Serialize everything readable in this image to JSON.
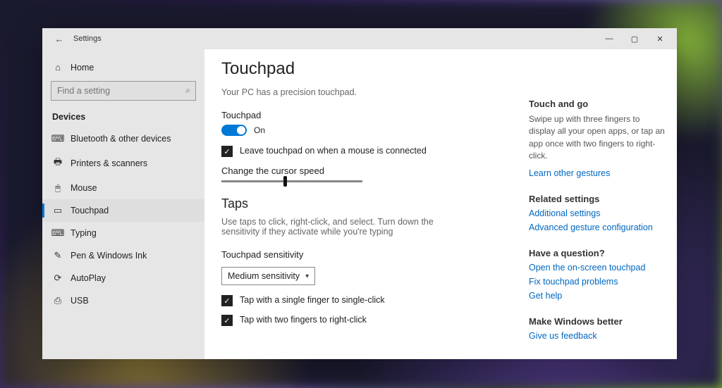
{
  "window": {
    "title": "Settings"
  },
  "sidebar": {
    "home_label": "Home",
    "search_placeholder": "Find a setting",
    "section_label": "Devices",
    "items": [
      {
        "label": "Bluetooth & other devices",
        "icon": "⌨"
      },
      {
        "label": "Printers & scanners",
        "icon": "🖶"
      },
      {
        "label": "Mouse",
        "icon": "🖱"
      },
      {
        "label": "Touchpad",
        "icon": "▭"
      },
      {
        "label": "Typing",
        "icon": "⌨"
      },
      {
        "label": "Pen & Windows Ink",
        "icon": "✎"
      },
      {
        "label": "AutoPlay",
        "icon": "⟳"
      },
      {
        "label": "USB",
        "icon": "⎙"
      }
    ],
    "active_index": 3
  },
  "main": {
    "heading": "Touchpad",
    "intro": "Your PC has a precision touchpad.",
    "touchpad_label": "Touchpad",
    "toggle_state_label": "On",
    "leave_on_label": "Leave touchpad on when a mouse is connected",
    "cursor_speed_label": "Change the cursor speed",
    "cursor_speed_percent": 45,
    "taps_heading": "Taps",
    "taps_desc": "Use taps to click, right-click, and select. Turn down the sensitivity if they activate while you're typing",
    "sensitivity_label": "Touchpad sensitivity",
    "sensitivity_value": "Medium sensitivity",
    "tap_single_label": "Tap with a single finger to single-click",
    "tap_two_label": "Tap with two fingers to right-click"
  },
  "aside": {
    "tng_title": "Touch and go",
    "tng_desc": "Swipe up with three fingers to display all your open apps, or tap an app once with two fingers to right-click.",
    "tng_link": "Learn other gestures",
    "related_title": "Related settings",
    "related_links": [
      "Additional settings",
      "Advanced gesture configuration"
    ],
    "question_title": "Have a question?",
    "question_links": [
      "Open the on-screen touchpad",
      "Fix touchpad problems",
      "Get help"
    ],
    "better_title": "Make Windows better",
    "better_link": "Give us feedback"
  }
}
